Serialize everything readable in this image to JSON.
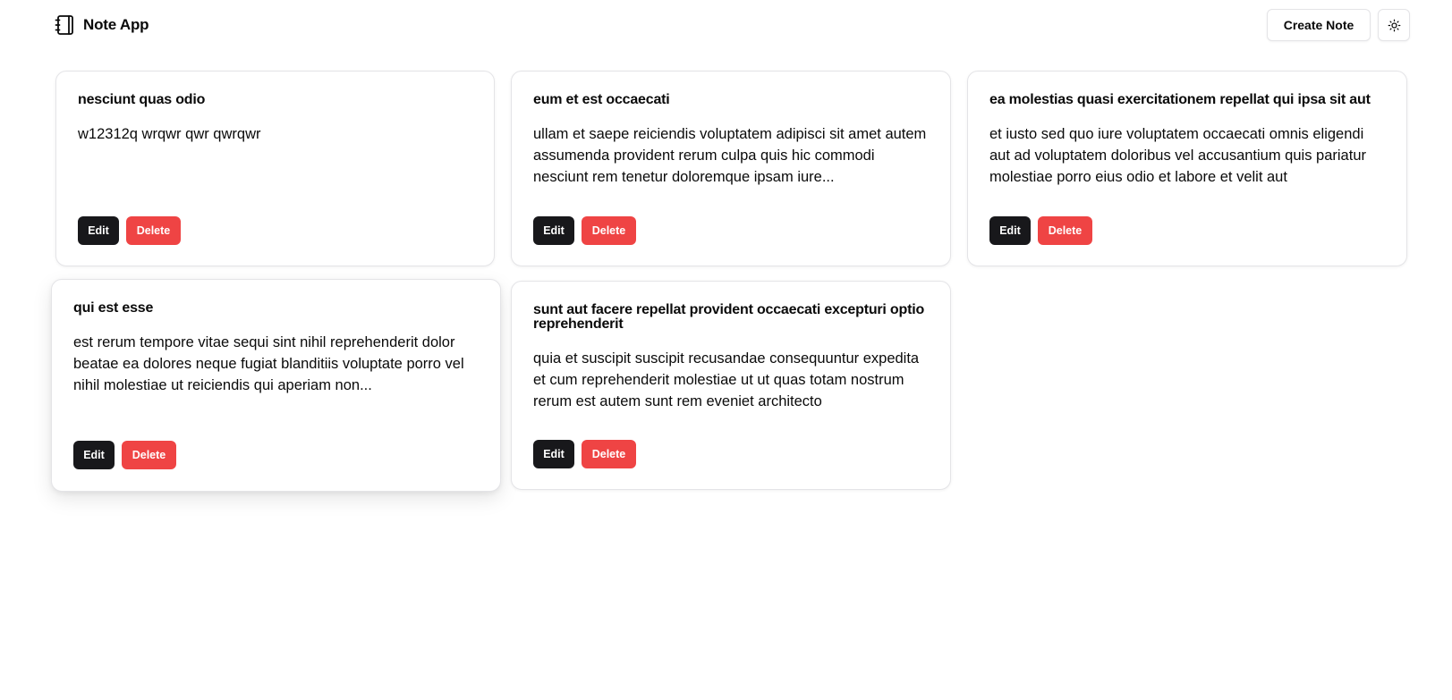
{
  "app": {
    "title": "Note App",
    "create_note_label": "Create Note",
    "theme_toggle_icon": "sun-icon",
    "brand_icon": "notebook-icon"
  },
  "colors": {
    "primary": "#18181b",
    "destructive": "#ef4444",
    "border": "#e4e4e7"
  },
  "notes": [
    {
      "title": "nesciunt quas odio",
      "body": "w12312q wrqwr qwr qwrqwr",
      "edit_label": "Edit",
      "delete_label": "Delete"
    },
    {
      "title": "eum et est occaecati",
      "body": "ullam et saepe reiciendis voluptatem adipisci sit amet autem assumenda provident rerum culpa quis hic commodi nesciunt rem tenetur doloremque ipsam iure...",
      "edit_label": "Edit",
      "delete_label": "Delete"
    },
    {
      "title": "ea molestias quasi exercitationem repellat qui ipsa sit aut",
      "body": "et iusto sed quo iure voluptatem occaecati omnis eligendi aut ad voluptatem doloribus vel accusantium quis pariatur molestiae porro eius odio et labore et velit aut",
      "edit_label": "Edit",
      "delete_label": "Delete"
    },
    {
      "title": "qui est esse",
      "body": "est rerum tempore vitae sequi sint nihil reprehenderit dolor beatae ea dolores neque fugiat blanditiis voluptate porro vel nihil molestiae ut reiciendis qui aperiam non...",
      "edit_label": "Edit",
      "delete_label": "Delete"
    },
    {
      "title": "sunt aut facere repellat provident occaecati excepturi optio reprehenderit",
      "body": "quia et suscipit suscipit recusandae consequuntur expedita et cum reprehenderit molestiae ut ut quas totam nostrum rerum est autem sunt rem eveniet architecto",
      "edit_label": "Edit",
      "delete_label": "Delete"
    }
  ]
}
